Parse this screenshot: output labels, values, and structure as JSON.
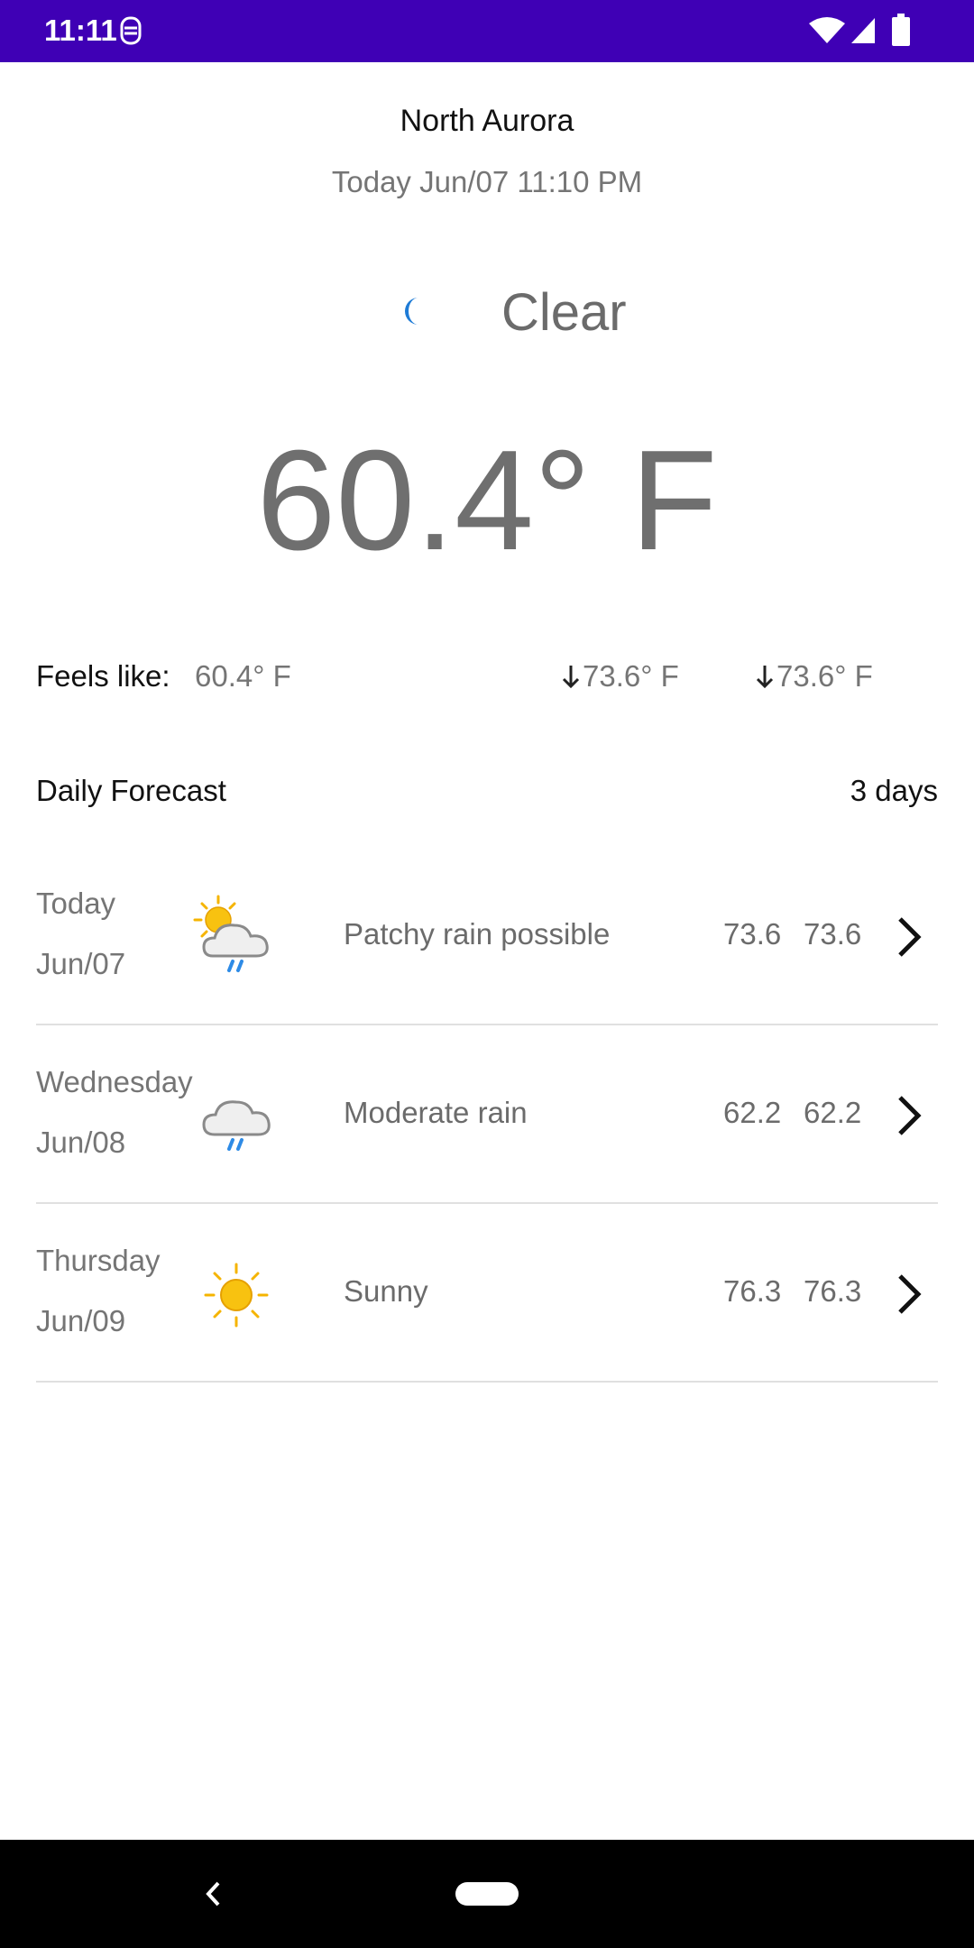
{
  "status_bar": {
    "time": "11:11",
    "background_color": "#3F00B5",
    "icons": [
      "alert-icon",
      "wifi-icon",
      "signal-icon",
      "battery-icon"
    ]
  },
  "header": {
    "location": "North Aurora",
    "datetime": "Today Jun/07 11:10 PM"
  },
  "current": {
    "icon": "moon-icon",
    "condition": "Clear",
    "temperature": "60.4° F",
    "feels_like_label": "Feels like:",
    "feels_like_value": "60.4° F",
    "minmax": [
      "73.6° F",
      "73.6° F"
    ]
  },
  "forecast": {
    "title": "Daily Forecast",
    "days_label": "3 days",
    "rows": [
      {
        "day": "Today",
        "date": "Jun/07",
        "icon": "partly-cloudy-rain-icon",
        "description": "Patchy rain possible",
        "high": "73.6",
        "low": "73.6"
      },
      {
        "day": "Wednesday",
        "date": "Jun/08",
        "icon": "cloud-rain-icon",
        "description": "Moderate rain",
        "high": "62.2",
        "low": "62.2"
      },
      {
        "day": "Thursday",
        "date": "Jun/09",
        "icon": "sun-icon",
        "description": "Sunny",
        "high": "76.3",
        "low": "76.3"
      }
    ]
  },
  "colors": {
    "accent": "#3F00B5",
    "moon": "#1E7BD6",
    "sun": "#F5B400",
    "rain": "#2E8BE6"
  },
  "nav_bar": {
    "icons": [
      "back-icon",
      "home-pill-icon"
    ]
  }
}
